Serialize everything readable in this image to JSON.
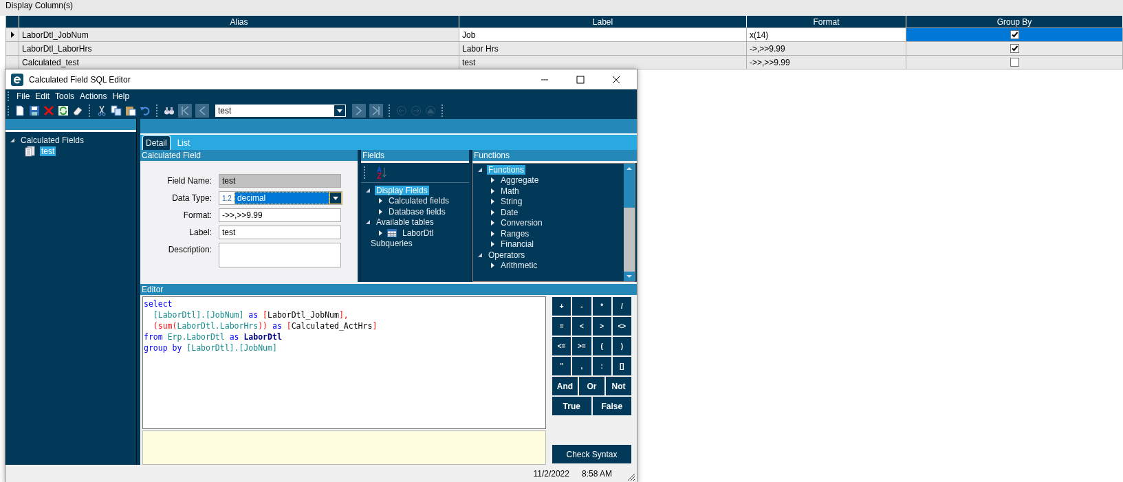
{
  "section_title": "Display Column(s)",
  "table": {
    "columns": [
      "Alias",
      "Label",
      "Format",
      "Group By"
    ],
    "rows": [
      {
        "alias": "LaborDtl_JobNum",
        "label": "Job",
        "format": "x(14)",
        "group_by": true,
        "selected": true
      },
      {
        "alias": "LaborDtl_LaborHrs",
        "label": "Labor Hrs",
        "format": "->,>>9.99",
        "group_by": true,
        "selected": false
      },
      {
        "alias": "Calculated_test",
        "label": "test",
        "format": "->>,>>9.99",
        "group_by": false,
        "selected": false
      }
    ]
  },
  "window": {
    "title": "Calculated Field SQL Editor"
  },
  "menu": [
    "File",
    "Edit",
    "Tools",
    "Actions",
    "Help"
  ],
  "navigator": {
    "value": "test"
  },
  "left_tree": [
    {
      "label": "Calculated Fields",
      "expanded": true,
      "selected": false,
      "children": [
        {
          "label": "test",
          "kind": "record",
          "selected": true
        }
      ]
    }
  ],
  "tabs": [
    {
      "label": "Detail",
      "selected": true
    },
    {
      "label": "List",
      "selected": false
    }
  ],
  "calc_panel": {
    "title": "Calculated Field",
    "fields": [
      {
        "kind": "text",
        "label": "Field Name:",
        "value": "test",
        "disabled": true
      },
      {
        "kind": "select",
        "label": "Data Type:",
        "prefix": "1.2",
        "value": "decimal",
        "disabled": false
      },
      {
        "kind": "text",
        "label": "Format:",
        "value": "->>,>>9.99",
        "disabled": false
      },
      {
        "kind": "text",
        "label": "Label:",
        "value": "test",
        "disabled": false
      },
      {
        "kind": "textarea",
        "label": "Description:",
        "disabled": false
      }
    ]
  },
  "fields_panel": {
    "title": "Fields",
    "tree": [
      {
        "label": "Display Fields",
        "expanded": true,
        "selected": true,
        "children": [
          {
            "label": "Calculated fields",
            "expanded": false,
            "selected": false
          },
          {
            "label": "Database fields",
            "expanded": false,
            "selected": false
          }
        ]
      },
      {
        "label": "Available tables",
        "expanded": true,
        "selected": false,
        "children": [
          {
            "label": "LaborDtl",
            "kind": "table",
            "expanded": false,
            "selected": false
          }
        ]
      },
      {
        "label": "Subqueries",
        "selected": false
      }
    ]
  },
  "functions_panel": {
    "title": "Functions",
    "tree": [
      {
        "label": "Functions",
        "expanded": true,
        "selected": true,
        "children": [
          {
            "label": "Aggregate",
            "expanded": false,
            "selected": false
          },
          {
            "label": "Math",
            "expanded": false,
            "selected": false
          },
          {
            "label": "String",
            "expanded": false,
            "selected": false
          },
          {
            "label": "Date",
            "expanded": false,
            "selected": false
          },
          {
            "label": "Conversion",
            "expanded": false,
            "selected": false
          },
          {
            "label": "Ranges",
            "expanded": false,
            "selected": false
          },
          {
            "label": "Financial",
            "expanded": false,
            "selected": false
          }
        ]
      },
      {
        "label": "Operators",
        "expanded": true,
        "selected": false,
        "children": [
          {
            "label": "Arithmetic",
            "expanded": false,
            "selected": false
          }
        ]
      }
    ]
  },
  "editor": {
    "title": "Editor",
    "lines": [
      [
        {
          "kind": "keyword",
          "text": "select"
        }
      ],
      [
        {
          "kind": "field",
          "text": "  [LaborDtl].[JobNum]"
        },
        {
          "kind": "keyword",
          "text": " as "
        },
        {
          "kind": "punct",
          "text": "["
        },
        {
          "kind": "plain",
          "text": "LaborDtl_JobNum"
        },
        {
          "kind": "punct",
          "text": "],"
        }
      ],
      [
        {
          "kind": "punct",
          "text": "  (sum("
        },
        {
          "kind": "field",
          "text": "LaborDtl.LaborHrs"
        },
        {
          "kind": "punct",
          "text": "))"
        },
        {
          "kind": "keyword",
          "text": " as "
        },
        {
          "kind": "punct",
          "text": "["
        },
        {
          "kind": "plain",
          "text": "Calculated_ActHrs"
        },
        {
          "kind": "punct",
          "text": "]"
        }
      ],
      [
        {
          "kind": "keyword",
          "text": "from "
        },
        {
          "kind": "field",
          "text": "Erp.LaborDtl"
        },
        {
          "kind": "keyword",
          "text": " as "
        },
        {
          "kind": "alias",
          "text": "LaborDtl"
        }
      ],
      [
        {
          "kind": "keyword",
          "text": "group by "
        },
        {
          "kind": "field",
          "text": "[LaborDtl].[JobNum]"
        }
      ]
    ]
  },
  "operators": [
    [
      "+",
      "-",
      "*",
      "/"
    ],
    [
      "=",
      "<",
      ">",
      "<>"
    ],
    [
      "<=",
      ">=",
      "(",
      ")"
    ],
    [
      "\"",
      ",",
      ":",
      "[]"
    ],
    [
      "And",
      "Or",
      "Not"
    ],
    [
      "True",
      "False"
    ]
  ],
  "check_button": "Check Syntax",
  "status_bar": {
    "date": "11/2/2022",
    "time": "8:58 AM"
  }
}
